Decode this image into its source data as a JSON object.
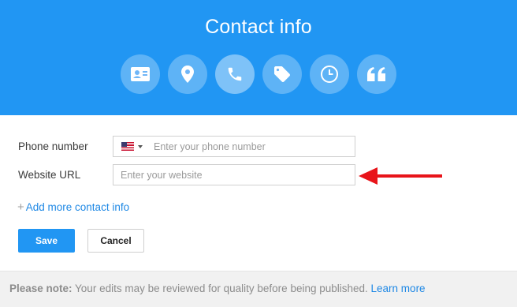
{
  "header": {
    "title": "Contact info",
    "categories": [
      {
        "icon": "contact-card-icon",
        "active": false
      },
      {
        "icon": "location-pin-icon",
        "active": false
      },
      {
        "icon": "phone-icon",
        "active": true
      },
      {
        "icon": "tag-icon",
        "active": false
      },
      {
        "icon": "clock-icon",
        "active": false
      },
      {
        "icon": "quote-icon",
        "active": false
      }
    ]
  },
  "form": {
    "phone": {
      "label": "Phone number",
      "placeholder": "Enter your phone number",
      "value": "",
      "country_flag": "us-flag-icon"
    },
    "website": {
      "label": "Website URL",
      "placeholder": "Enter your website",
      "value": ""
    },
    "add_more": {
      "plus": "+",
      "label": "Add more contact info"
    }
  },
  "buttons": {
    "save": "Save",
    "cancel": "Cancel"
  },
  "footer": {
    "note_bold": "Please note:",
    "note_text": " Your edits may be reviewed for quality before being published. ",
    "learn_more": "Learn more"
  },
  "annotation": {
    "arrow_color": "#e8141a",
    "arrow_direction": "left"
  },
  "colors": {
    "brand_blue": "#2196f3",
    "link_blue": "#1e88e5"
  }
}
